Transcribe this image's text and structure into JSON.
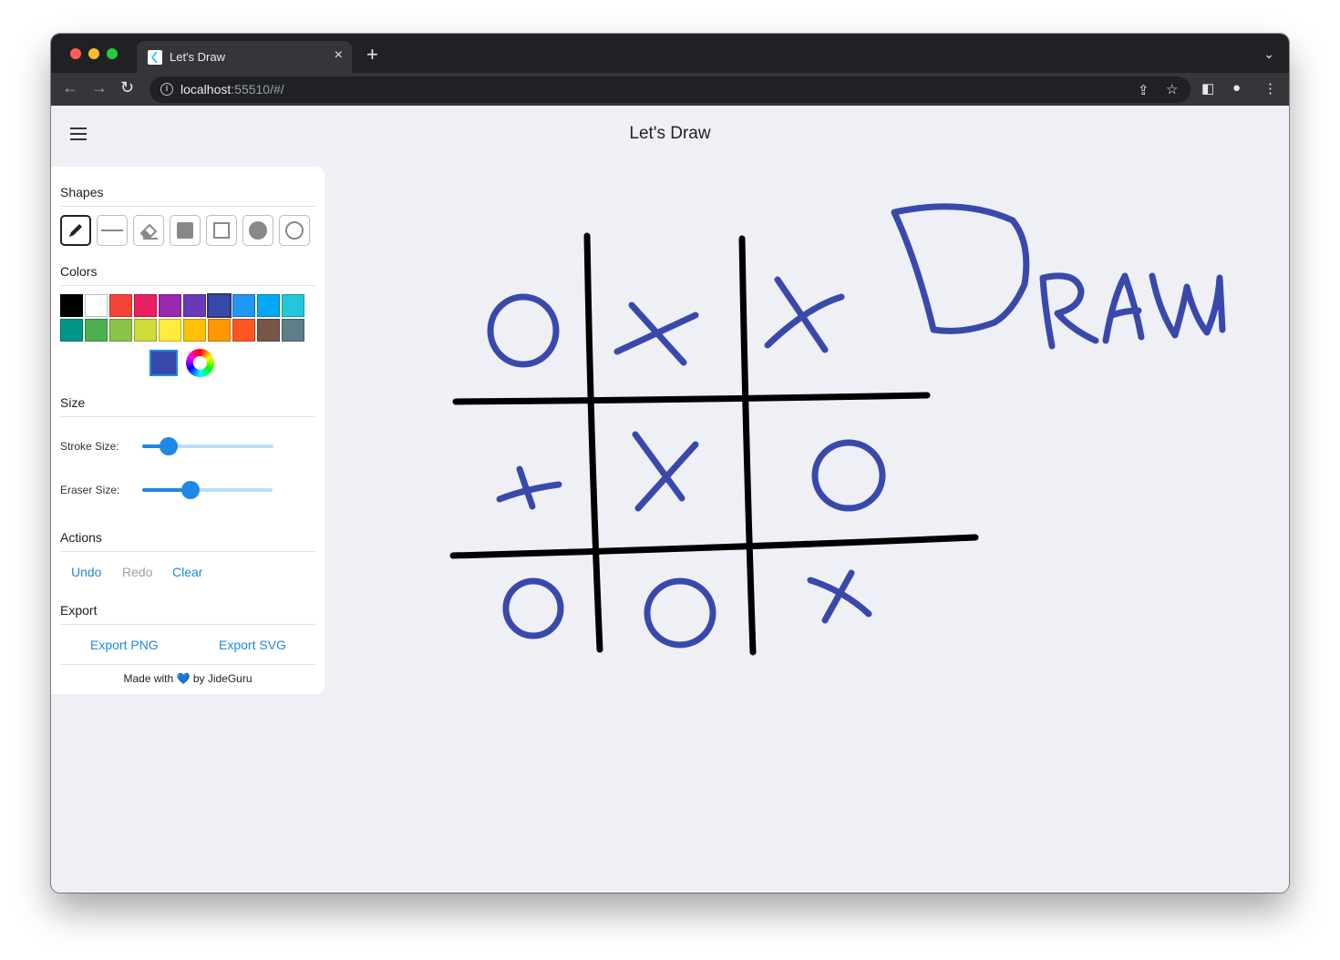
{
  "browser": {
    "tab_title": "Let's Draw",
    "tab_close": "×",
    "new_tab": "+",
    "tab_list": "⌄",
    "back": "←",
    "forward": "→",
    "reload": "↻",
    "info": "i",
    "url_host": "localhost",
    "url_rest": ":55510/#/",
    "share": "⇪",
    "bookmark": "☆",
    "sidepanel": "◧",
    "profile": "●",
    "menu": "⋮"
  },
  "app": {
    "title": "Let's Draw"
  },
  "panel": {
    "shapes_title": "Shapes",
    "shapes": [
      {
        "name": "pencil",
        "active": true
      },
      {
        "name": "line",
        "active": false
      },
      {
        "name": "eraser",
        "active": false
      },
      {
        "name": "filled-square",
        "active": false
      },
      {
        "name": "square",
        "active": false
      },
      {
        "name": "filled-circle",
        "active": false
      },
      {
        "name": "circle",
        "active": false
      }
    ],
    "colors_title": "Colors",
    "palette_row1": [
      "#000000",
      "#ffffff",
      "#f44336",
      "#e91e63",
      "#9c27b0",
      "#673ab7",
      "#3949ab",
      "#2196f3",
      "#03a9f4",
      "#26c6da"
    ],
    "palette_row2": [
      "#009688",
      "#4caf50",
      "#8bc34a",
      "#cddc39",
      "#ffeb3b",
      "#ffc107",
      "#ff9800",
      "#ff5722",
      "#795548",
      "#607d8b"
    ],
    "selected_color": "#3949ab",
    "size_title": "Size",
    "stroke_label": "Stroke Size:",
    "stroke_value": 0.2,
    "eraser_label": "Eraser Size:",
    "eraser_value": 0.37,
    "actions_title": "Actions",
    "undo": "Undo",
    "redo": "Redo",
    "clear": "Clear",
    "export_title": "Export",
    "export_png": "Export PNG",
    "export_svg": "Export SVG",
    "footer_prefix": "Made with",
    "footer_heart": "💙",
    "footer_suffix": "by JideGuru"
  },
  "drawing": {
    "ink_color": "#3949ab",
    "grid_color": "#000000"
  }
}
